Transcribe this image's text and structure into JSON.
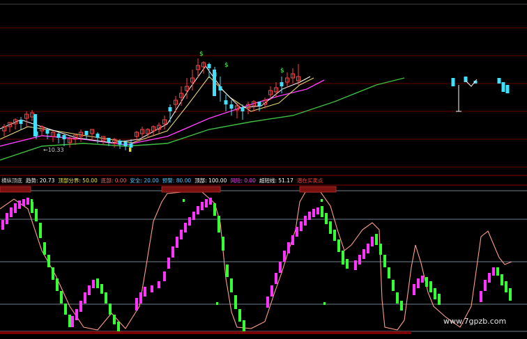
{
  "indicator_header": {
    "items": [
      {
        "text": "横纵顶底",
        "color": "#d8d8d8"
      },
      {
        "text": "趋势: 20.73",
        "color": "#ffffff"
      },
      {
        "text": "顶部分界: 50.00",
        "color": "#f2e94e"
      },
      {
        "text": "底部: 0.00",
        "color": "#ff6060"
      },
      {
        "text": "安全: 20.00",
        "color": "#4fc3ff"
      },
      {
        "text": "预警: 80.00",
        "color": "#4fc3ff"
      },
      {
        "text": "顶部: 100.00",
        "color": "#ffffff"
      },
      {
        "text": "风险: 0.00",
        "color": "#ff40ff"
      },
      {
        "text": "超短线: 51.17",
        "color": "#ffffff"
      },
      {
        "text": "潜在买卖点",
        "color": "#ff4040"
      }
    ]
  },
  "price_low_label": "←10.33",
  "watermark": "www.7gpzb.com",
  "colors": {
    "background": "#000000",
    "grid": "#6a0000",
    "up_candle": "#ff4040",
    "down_candle": "#40e0ff",
    "ma_short": "#ffffff",
    "ma_mid": "#e6d27a",
    "ma_long1": "#ff40ff",
    "ma_long2": "#40c040",
    "osc_up": "#ff33ff",
    "osc_down": "#33ff33",
    "osc_line": "#ff9e8a",
    "level_lines": "#c8e6ff"
  },
  "chart_data": [
    {
      "type": "candlestick",
      "title": "",
      "price_low_label": "10.33",
      "markers": [
        "$",
        "$",
        "$"
      ],
      "ylim": [
        9.0,
        16.0
      ],
      "moving_averages": [
        "short",
        "mid",
        "long1",
        "long2"
      ]
    },
    {
      "type": "line",
      "title": "横纵顶底",
      "levels": [
        0,
        20,
        50,
        80,
        100
      ],
      "ylim": [
        0,
        100
      ],
      "series": [
        {
          "name": "趋势",
          "last_value": 20.73
        },
        {
          "name": "超短线",
          "last_value": 51.17
        }
      ]
    }
  ]
}
